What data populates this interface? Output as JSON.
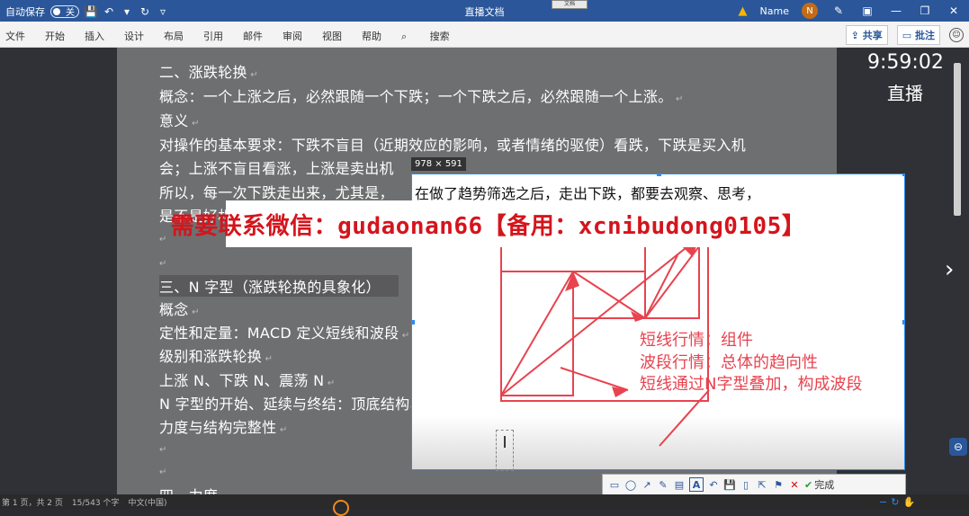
{
  "titlebar": {
    "autosave_label": "自动保存",
    "toggle_state": "关",
    "doc_title": "直播文档",
    "user_name": "Name",
    "avatar_initial": "N",
    "floating_tab": "文档"
  },
  "ribbon": {
    "tabs": [
      "文件",
      "开始",
      "插入",
      "设计",
      "布局",
      "引用",
      "邮件",
      "审阅",
      "视图",
      "帮助",
      "搜索"
    ],
    "share_label": "共享",
    "comment_label": "批注"
  },
  "document": {
    "lines": [
      "二、涨跌轮换",
      "概念：一个上涨之后，必然跟随一个下跌；一个下跌之后，必然跟随一个上涨。",
      "意义",
      "对操作的基本要求：下跌不盲目（近期效应的影响，或者情绪的驱使）看跌，下跌是买入机",
      "会；上涨不盲目看涨，上涨是卖出机",
      "所以，每一次下跌走出来，尤其是，",
      "是不是好机",
      "",
      "",
      "三、N 字型（涨跌轮换的具象化）",
      "概念",
      "定性和定量：MACD 定义短线和波段",
      "级别和涨跌轮换",
      "上涨 N、下跌 N、震荡 N",
      "N 字型的开始、延续与终结：顶底结构、V 转",
      "力度与结构完整性",
      "",
      "",
      "四、力度"
    ]
  },
  "overlay": {
    "clock": "9:59:02",
    "live_label": "直播",
    "selection_size": "978 × 591"
  },
  "screenshot": {
    "line1": "在做了趋势筛选之后，走出下跌，都要去观察、思考，",
    "annotations": [
      "短线行情：组件",
      "波段行情：总体的趋向性",
      "短线通过N字型叠加，构成波段"
    ],
    "cursor_glyph": "I"
  },
  "banner": {
    "text": "需要联系微信：gudaonan66【备用：xcnibudong0105】"
  },
  "snip_toolbar": {
    "done_label": "完成",
    "font_size": "10"
  },
  "statusbar": {
    "page": "第 1 页，共 2 页",
    "words": "15/543 个字",
    "lang": "中文(中国)"
  },
  "colors": {
    "title_blue": "#2b579a",
    "annotation_red": "#e8434f",
    "banner_red": "#d5141c",
    "selection_blue": "#2d8cf0"
  }
}
